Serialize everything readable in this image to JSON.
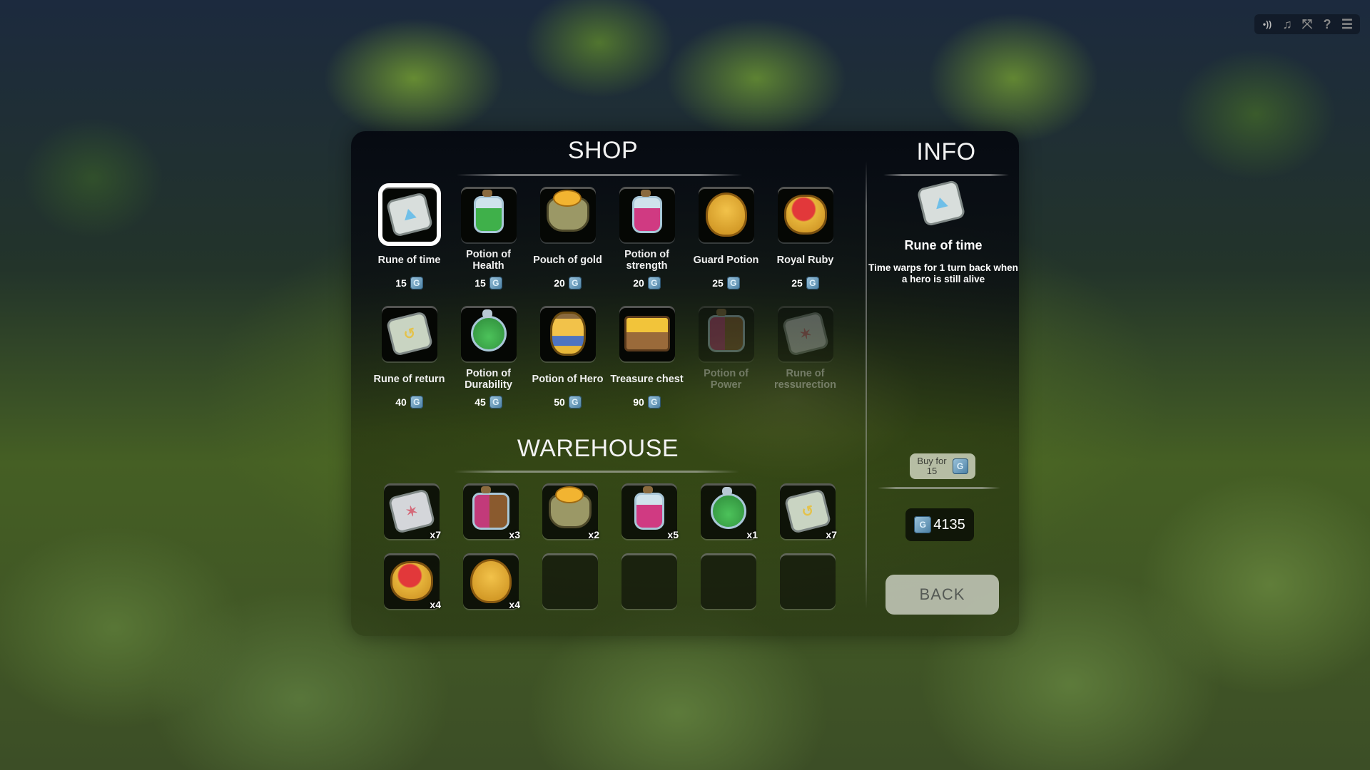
{
  "hud": {
    "buttons": [
      {
        "name": "sound-icon",
        "glyph": "•))"
      },
      {
        "name": "music-icon",
        "glyph": "♫"
      },
      {
        "name": "fullscreen-icon",
        "glyph": "⤧"
      },
      {
        "name": "help-icon",
        "glyph": "?"
      },
      {
        "name": "menu-icon",
        "glyph": "☰"
      }
    ]
  },
  "shop": {
    "title": "SHOP",
    "selected_index": 0,
    "items": [
      {
        "name": "Rune of time",
        "price": "15",
        "icon": "rune-of-time-icon",
        "available": true
      },
      {
        "name": "Potion of Health",
        "price": "15",
        "icon": "health-potion-icon",
        "available": true
      },
      {
        "name": "Pouch of gold",
        "price": "20",
        "icon": "gold-pouch-icon",
        "available": true
      },
      {
        "name": "Potion of strength",
        "price": "20",
        "icon": "strength-potion-icon",
        "available": true
      },
      {
        "name": "Guard Potion",
        "price": "25",
        "icon": "guard-potion-icon",
        "available": true
      },
      {
        "name": "Royal Ruby",
        "price": "25",
        "icon": "royal-ruby-icon",
        "available": true
      },
      {
        "name": "Rune of return",
        "price": "40",
        "icon": "rune-of-return-icon",
        "available": true
      },
      {
        "name": "Potion of Durability",
        "price": "45",
        "icon": "durability-potion-icon",
        "available": true
      },
      {
        "name": "Potion of Hero",
        "price": "50",
        "icon": "hero-potion-icon",
        "available": true
      },
      {
        "name": "Treasure chest",
        "price": "90",
        "icon": "treasure-chest-icon",
        "available": true
      },
      {
        "name": "Potion of Power",
        "price": "",
        "icon": "power-potion-icon",
        "available": false
      },
      {
        "name": "Rune of ressurection",
        "price": "",
        "icon": "rune-of-ressurection-icon",
        "available": false
      }
    ]
  },
  "warehouse": {
    "title": "WAREHOUSE",
    "slots": [
      {
        "icon": "rune-of-ressurection-icon",
        "qty": "x7"
      },
      {
        "icon": "power-potion-icon",
        "qty": "x3"
      },
      {
        "icon": "gold-pouch-icon",
        "qty": "x2"
      },
      {
        "icon": "strength-potion-icon",
        "qty": "x5"
      },
      {
        "icon": "durability-potion-icon",
        "qty": "x1"
      },
      {
        "icon": "rune-of-return-icon",
        "qty": "x7"
      },
      {
        "icon": "royal-ruby-icon",
        "qty": "x4"
      },
      {
        "icon": "guard-potion-icon",
        "qty": "x4"
      },
      {
        "icon": "",
        "qty": ""
      },
      {
        "icon": "",
        "qty": ""
      },
      {
        "icon": "",
        "qty": ""
      },
      {
        "icon": "",
        "qty": ""
      }
    ]
  },
  "info": {
    "title": "INFO",
    "item_name": "Rune of time",
    "description": "Time warps for 1 turn back when a hero is still alive",
    "buy_label": "Buy for",
    "buy_price": "15",
    "balance": "4135",
    "back_label": "BACK"
  },
  "colors": {
    "currency": "#6a9ec0",
    "panel": "#05080f"
  }
}
